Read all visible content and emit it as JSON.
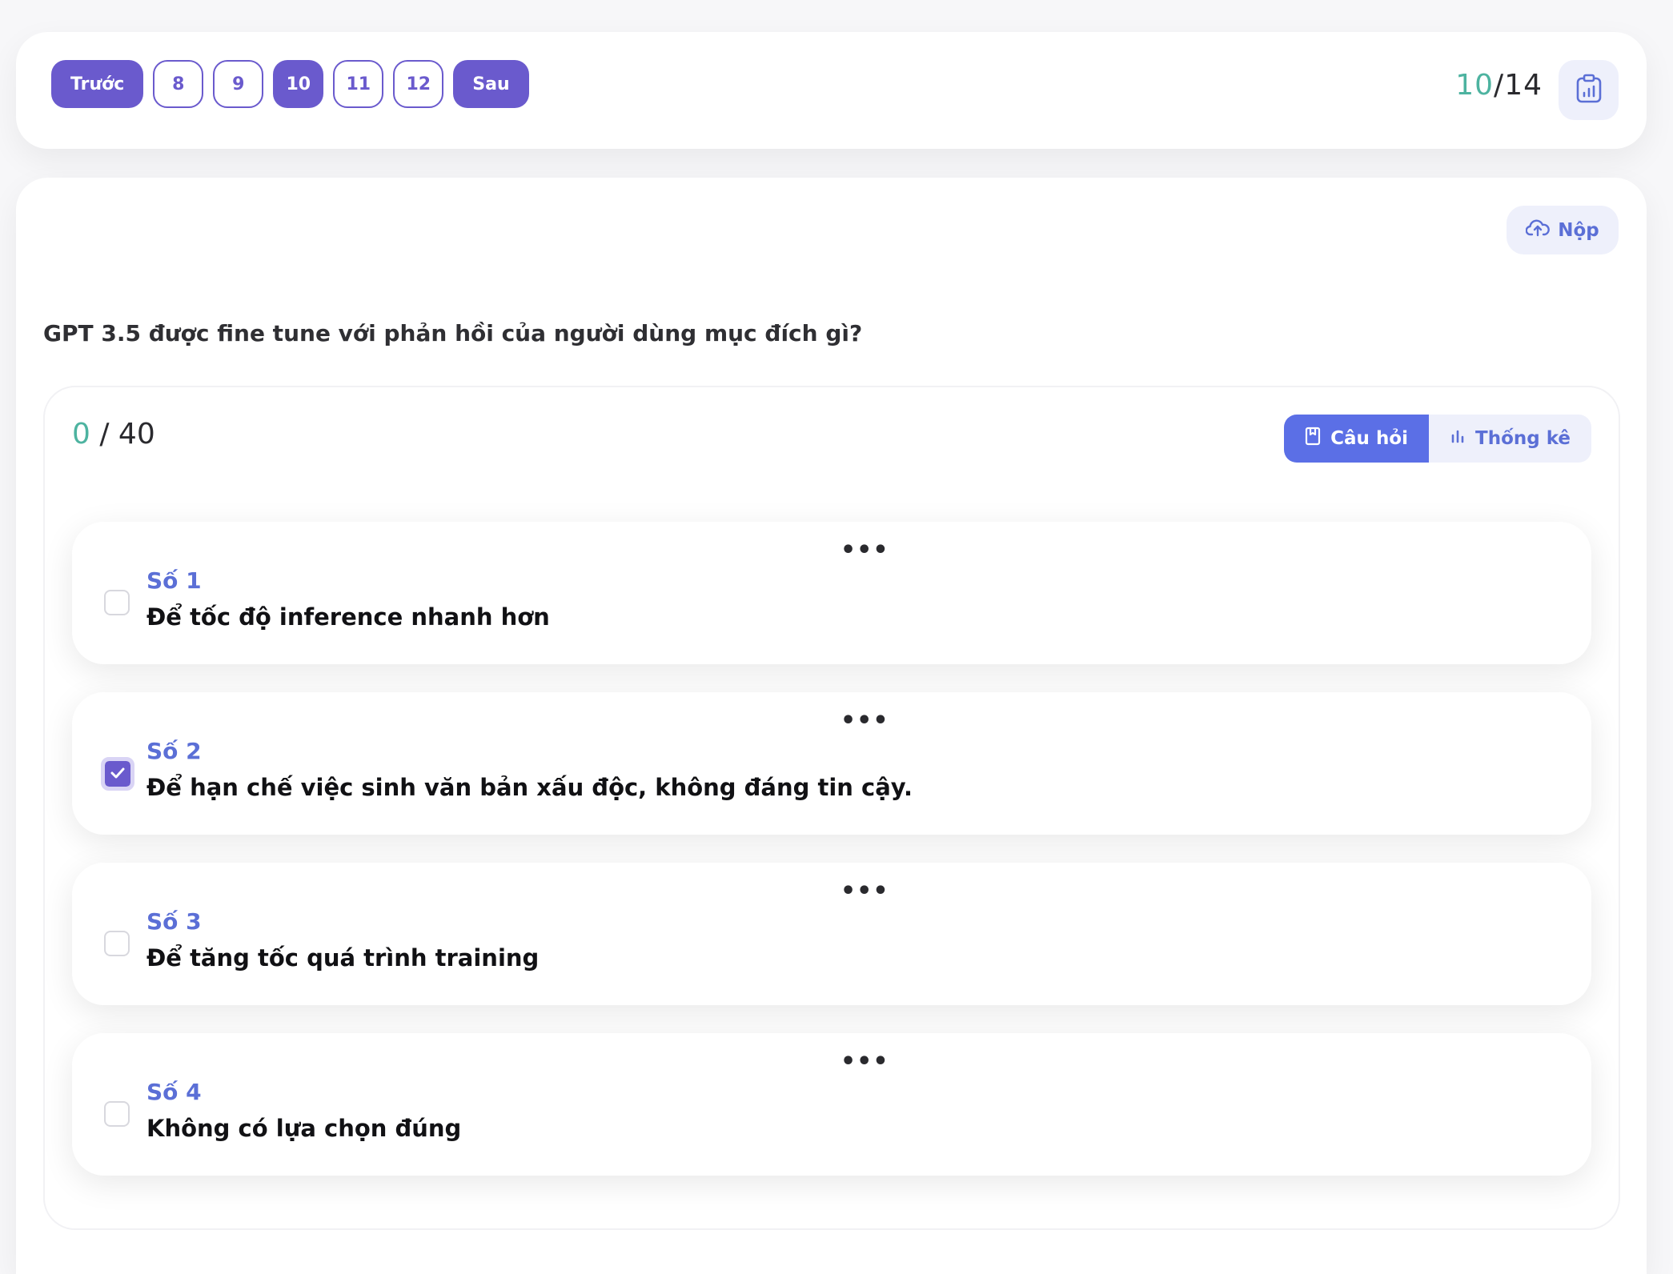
{
  "pagination": {
    "prev_label": "Trước",
    "next_label": "Sau",
    "pages": [
      "8",
      "9",
      "10",
      "11",
      "12"
    ],
    "current_page": "10"
  },
  "progress": {
    "done": "10",
    "separator": "/",
    "total": "14"
  },
  "icons": {
    "report": "clipboard-chart-icon",
    "submit": "cloud-upload-icon",
    "questions_tab": "bookmark-icon",
    "stats_tab": "bar-chart-icon",
    "more": "more-dots-icon",
    "check": "checkmark-icon"
  },
  "submit_label": "Nộp",
  "question_text": "GPT 3.5 được fine tune với phản hồi của người dùng mục đích gì?",
  "score": {
    "got": "0",
    "rest": "/ 40"
  },
  "tabs": {
    "questions": "Câu hỏi",
    "stats": "Thống kê",
    "active": "questions"
  },
  "more_label": "•••",
  "options": [
    {
      "number": "Số 1",
      "text": "Để tốc độ inference nhanh hơn",
      "checked": false
    },
    {
      "number": "Số 2",
      "text": "Để hạn chế việc sinh văn bản xấu độc, không đáng tin cậy.",
      "checked": true
    },
    {
      "number": "Số 3",
      "text": "Để tăng tốc quá trình training",
      "checked": false
    },
    {
      "number": "Số 4",
      "text": "Không có lựa chọn đúng",
      "checked": false
    }
  ],
  "colors": {
    "accent": "#6a5acd",
    "tab_active": "#5b6fe6",
    "link_blue": "#5b6fd6",
    "score_green": "#4db3a0",
    "soft_bg": "#eef0fb"
  }
}
